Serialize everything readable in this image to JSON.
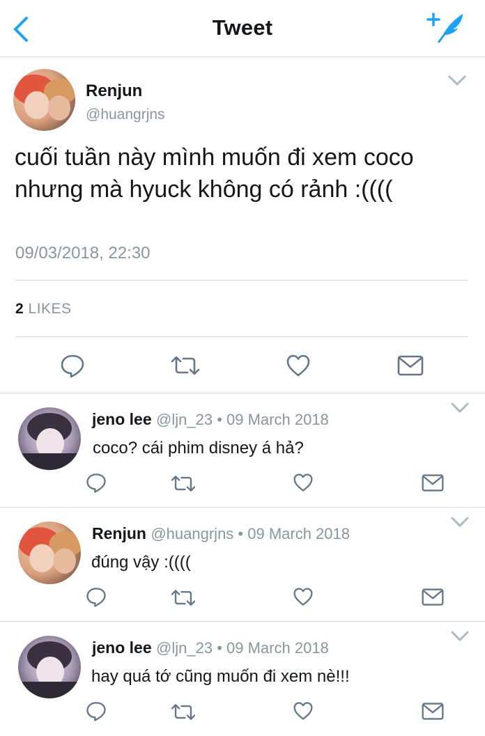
{
  "nav": {
    "title": "Tweet",
    "back_icon": "back-chevron-icon",
    "compose_icon": "compose-feather-icon"
  },
  "colors": {
    "accent": "#1da1f2",
    "secondary_text": "#8a959e",
    "divider": "#d8dde2",
    "primary_text": "#14171a"
  },
  "tweet": {
    "display_name": "Renjun",
    "handle": "@huangrjns",
    "text": "cuối tuần này mình muốn đi xem coco nhưng mà hyuck không có rảnh :((((",
    "timestamp": "09/03/2018, 22:30",
    "likes_count": "2",
    "likes_label": "LIKES",
    "actions": [
      "reply-icon",
      "retweet-icon",
      "like-icon",
      "message-icon"
    ]
  },
  "replies": [
    {
      "display_name": "jeno lee",
      "meta": "@ljn_23 • 09 March 2018",
      "text": "coco? cái phim disney á hả?"
    },
    {
      "display_name": "Renjun",
      "meta": "@huangrjns • 09 March 2018",
      "text": "đúng vậy :(((("
    },
    {
      "display_name": "jeno lee",
      "meta": "@ljn_23 • 09 March 2018",
      "text": "hay quá tớ cũng muốn đi xem nè!!!"
    }
  ]
}
